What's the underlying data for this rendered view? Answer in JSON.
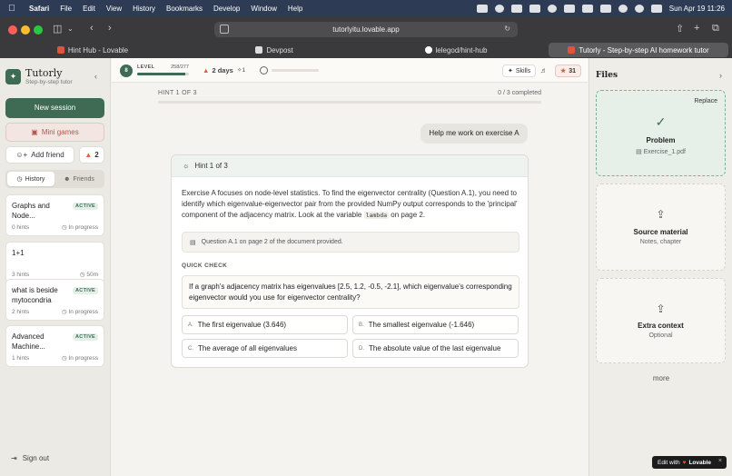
{
  "menubar": {
    "app": "Safari",
    "items": [
      "File",
      "Edit",
      "View",
      "History",
      "Bookmarks",
      "Develop",
      "Window",
      "Help"
    ],
    "clock": "Sun Apr 19  11:26"
  },
  "browser": {
    "url": "tutorlyitu.lovable.app",
    "tabs": [
      {
        "label": "Hint Hub - Lovable",
        "color": "#e0533d"
      },
      {
        "label": "Devpost",
        "color": "#dddddd"
      },
      {
        "label": "lelegod/hint-hub",
        "color": "#ffffff"
      },
      {
        "label": "Tutorly - Step-by-step AI homework tutor",
        "color": "#e0533d"
      }
    ]
  },
  "sidebar": {
    "brand": "Tutorly",
    "tagline": "Step-by-step tutor",
    "new_session": "New session",
    "mini_games": "Mini games",
    "add_friend": "Add friend",
    "streak": "2",
    "tabs": [
      "History",
      "Friends"
    ],
    "history": [
      {
        "title": "Graphs and Node...",
        "badge": "ACTIVE",
        "meta": "0 hints",
        "status": "In progress"
      },
      {
        "title": "1+1",
        "badge": "",
        "meta": "3 hints",
        "status": "50m"
      },
      {
        "title": "what is beside mytocondria",
        "badge": "ACTIVE",
        "meta": "2 hints",
        "status": "In progress"
      },
      {
        "title": "Advanced Machine...",
        "badge": "ACTIVE",
        "meta": "1 hints",
        "status": "In progress"
      }
    ],
    "sign_out": "Sign out"
  },
  "topbar": {
    "level": "8",
    "level_label": "LEVEL",
    "xp": "258/277",
    "xp_fraction": 0.93,
    "streak": "2 days",
    "gems": "1",
    "skills": "Skills",
    "points": "31"
  },
  "main": {
    "hint_counter": "HINT 1 OF 3",
    "completed": "0 / 3 completed",
    "user_message": "Help me work on exercise A",
    "hint_title": "Hint 1 of 3",
    "hint_text_before": "Exercise A focuses on node-level statistics. To find the eigenvector centrality (Question A.1), you need to identify which eigenvalue-eigenvector pair from the provided NumPy output corresponds to the 'principal' component of the adjacency matrix. Look at the variable ",
    "hint_code": "lambda",
    "hint_text_after": " on page 2.",
    "note": "Question A.1 on page 2 of the document provided.",
    "quick_check": "QUICK CHECK",
    "question": "If a graph's adjacency matrix has eigenvalues [2.5, 1.2, -0.5, -2.1], which eigenvalue's corresponding eigenvector would you use for eigenvector centrality?",
    "options": [
      {
        "key": "A.",
        "text": "The first eigenvalue (3.646)"
      },
      {
        "key": "B.",
        "text": "The smallest eigenvalue (-1.646)"
      },
      {
        "key": "C.",
        "text": "The average of all eigenvalues"
      },
      {
        "key": "D.",
        "text": "The absolute value of the last eigenvalue"
      }
    ]
  },
  "files": {
    "title": "Files",
    "problem": {
      "replace": "Replace",
      "title": "Problem",
      "file": "Exercise_1.pdf"
    },
    "source": {
      "title": "Source material",
      "sub": "Notes, chapter"
    },
    "extra": {
      "title": "Extra context",
      "sub": "Optional"
    },
    "more": "more"
  },
  "badge": {
    "edit_with": "Edit with",
    "brand": "Lovable"
  },
  "colors": {
    "accent": "#3f6b55",
    "chrome": "#3a3a3c",
    "menubar": "#2d3b55"
  }
}
